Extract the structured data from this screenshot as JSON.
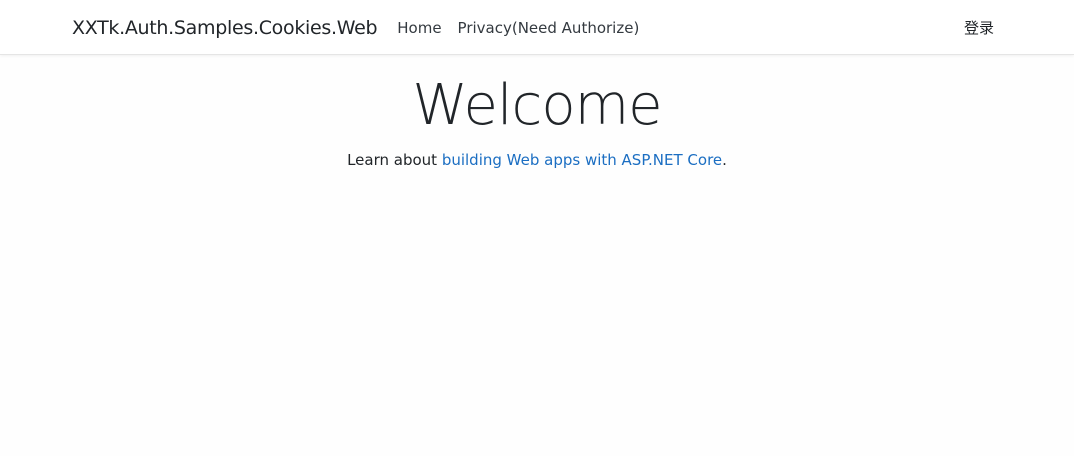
{
  "header": {
    "brand": "XXTk.Auth.Samples.Cookies.Web",
    "nav": [
      {
        "label": "Home"
      },
      {
        "label": "Privacy(Need Authorize)"
      }
    ],
    "login_label": "登录"
  },
  "main": {
    "title": "Welcome",
    "lead_prefix": "Learn about ",
    "lead_link": "building Web apps with ASP.NET Core",
    "lead_suffix": "."
  },
  "colors": {
    "link": "#1b6ec2",
    "text": "#212529",
    "navbar_border": "#e5e5e5"
  }
}
